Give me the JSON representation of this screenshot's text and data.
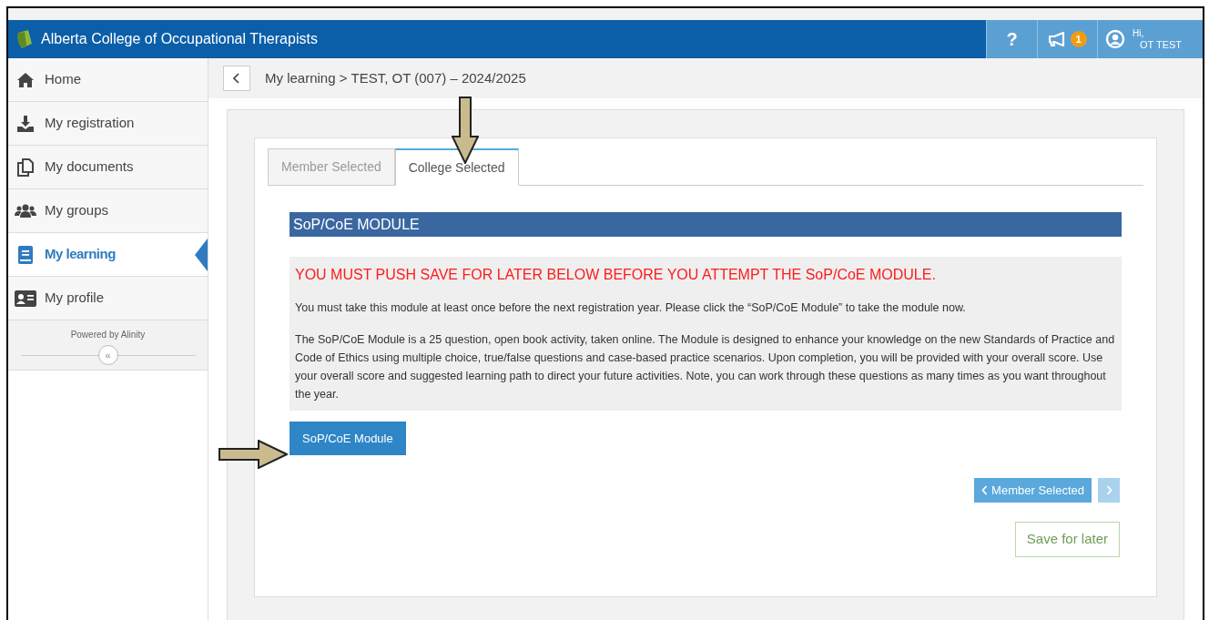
{
  "header": {
    "title": "Alberta College of Occupational Therapists",
    "help": "?",
    "notification_count": "1",
    "greeting": "Hi,",
    "user": "OT TEST"
  },
  "sidebar": {
    "items": [
      {
        "label": "Home",
        "selected": false
      },
      {
        "label": "My registration",
        "selected": false
      },
      {
        "label": "My documents",
        "selected": false
      },
      {
        "label": "My groups",
        "selected": false
      },
      {
        "label": "My learning",
        "selected": true
      },
      {
        "label": "My profile",
        "selected": false
      }
    ],
    "powered_by": "Powered by Alinity",
    "collapse": "«"
  },
  "breadcrumb": {
    "parent": "My learning >",
    "current": "TEST, OT (007) – 2024/2025"
  },
  "tabs": [
    {
      "label": "Member Selected",
      "selected": false
    },
    {
      "label": "College Selected",
      "selected": true
    }
  ],
  "section": {
    "title": "SoP/CoE MODULE",
    "warning": "YOU MUST PUSH SAVE FOR LATER BELOW BEFORE YOU ATTEMPT THE SoP/CoE MODULE.",
    "paragraphs": [
      "You must take this module at least once before the next registration year. Please click the “SoP/CoE Module” to take the module now.",
      "The SoP/CoE Module is a 25 question, open book activity, taken online. The Module is designed to enhance your knowledge on the new Standards of Practice and Code of Ethics using multiple choice, true/false questions and case-based practice scenarios. Upon completion, you will be provided with your overall score. Use your overall score and suggested learning path to direct your future activities. Note, you can work through these questions as many times as you want throughout the year."
    ],
    "module_button": "SoP/CoE Module"
  },
  "navigation": {
    "previous": "Member Selected",
    "next_disabled": true
  },
  "save_button": "Save for later"
}
